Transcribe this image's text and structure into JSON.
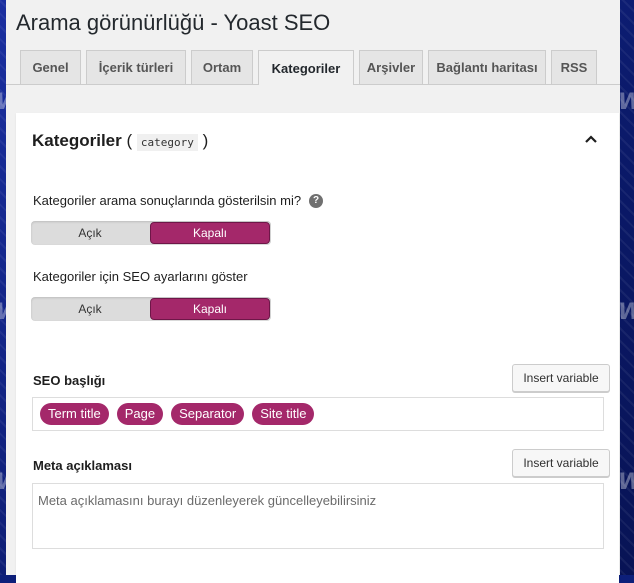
{
  "page": {
    "title": "Arama görünürlüğü - Yoast SEO"
  },
  "tabs": [
    {
      "label": "Genel"
    },
    {
      "label": "İçerik türleri"
    },
    {
      "label": "Ortam"
    },
    {
      "label": "Kategoriler",
      "active": true
    },
    {
      "label": "Arşivler"
    },
    {
      "label": "Bağlantı haritası"
    },
    {
      "label": "RSS"
    }
  ],
  "card": {
    "title": "Kategoriler",
    "code": "category",
    "paren_open": "(",
    "paren_close": ")",
    "collapse_icon": "chevron-up-icon"
  },
  "question1": {
    "label": "Kategoriler arama sonuçlarında gösterilsin mi?",
    "help_icon": "?",
    "options": [
      "Açık",
      "Kapalı"
    ],
    "selected": "Kapalı"
  },
  "question2": {
    "label": "Kategoriler için SEO ayarlarını göster",
    "options": [
      "Açık",
      "Kapalı"
    ],
    "selected": "Kapalı"
  },
  "seo_title": {
    "label": "SEO başlığı",
    "button": "Insert variable",
    "variables": [
      "Term title",
      "Page",
      "Separator",
      "Site title"
    ]
  },
  "meta": {
    "label": "Meta açıklaması",
    "button": "Insert variable",
    "placeholder": "Meta açıklamasını burayı düzenleyerek güncelleyebilirsiniz"
  },
  "colors": {
    "accent": "#a4286a",
    "background": "#f1f1f1"
  },
  "watermark": "WP"
}
